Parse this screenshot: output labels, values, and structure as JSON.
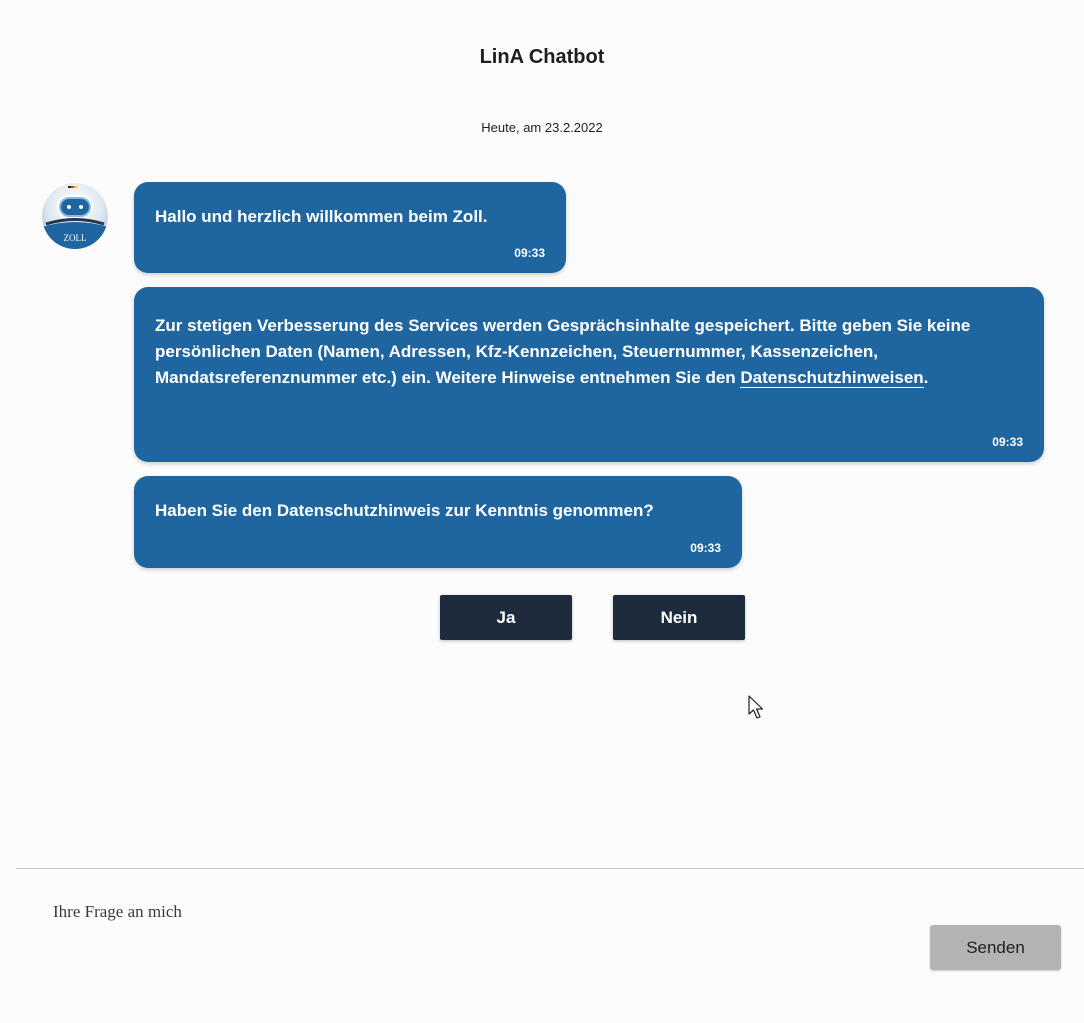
{
  "header": {
    "title": "LinA Chatbot",
    "date": "Heute, am 23.2.2022"
  },
  "avatar": {
    "label": "ZOLL",
    "icon": "robot-avatar-icon"
  },
  "messages": [
    {
      "text": "Hallo und herzlich willkommen beim Zoll.",
      "time": "09:33"
    },
    {
      "text": "Zur stetigen Verbesserung des Services werden Gesprächsinhalte gespeichert. Bitte geben Sie keine persönlichen Daten (Namen, Adressen, Kfz-Kennzeichen, Steuernummer, Kassenzeichen, Mandatsreferenznummer etc.) ein. Weitere Hinweise entnehmen Sie den ",
      "link": "Datenschutzhinweisen",
      "suffix": ".",
      "time": "09:33"
    },
    {
      "text": "Haben Sie den Datenschutzhinweis zur Kenntnis genommen?",
      "time": "09:33"
    }
  ],
  "choices": {
    "yes": "Ja",
    "no": "Nein"
  },
  "composer": {
    "placeholder": "Ihre Frage an mich",
    "value": "",
    "send_label": "Senden"
  },
  "colors": {
    "bubble": "#1f66a0",
    "choice_button": "#1e2b3d",
    "send_button": "#b3b3b3",
    "background": "#fbfcfb"
  }
}
